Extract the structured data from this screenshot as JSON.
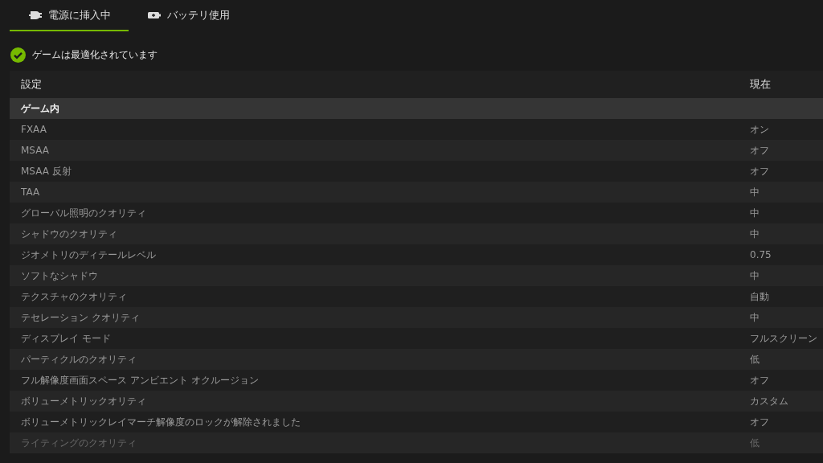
{
  "tabs": [
    {
      "label": "電源に挿入中",
      "selected": true
    },
    {
      "label": "バッテリ使用",
      "selected": false
    }
  ],
  "status": {
    "optimized": true,
    "text": "ゲームは最適化されています"
  },
  "table": {
    "columns": [
      "設定",
      "現在"
    ],
    "rows": [
      {
        "kind": "section",
        "setting": "ゲーム内"
      },
      {
        "kind": "setting",
        "setting": "FXAA",
        "value": "オン"
      },
      {
        "kind": "setting",
        "setting": "MSAA",
        "value": "オフ"
      },
      {
        "kind": "setting",
        "setting": "MSAA 反射",
        "value": "オフ"
      },
      {
        "kind": "setting",
        "setting": "TAA",
        "value": "中"
      },
      {
        "kind": "setting",
        "setting": "グローバル照明のクオリティ",
        "value": "中"
      },
      {
        "kind": "setting",
        "setting": "シャドウのクオリティ",
        "value": "中"
      },
      {
        "kind": "setting",
        "setting": "ジオメトリのディテールレベル",
        "value": "0.75"
      },
      {
        "kind": "setting",
        "setting": "ソフトなシャドウ",
        "value": "中"
      },
      {
        "kind": "setting",
        "setting": "テクスチャのクオリティ",
        "value": "自動"
      },
      {
        "kind": "setting",
        "setting": "テセレーション クオリティ",
        "value": "中"
      },
      {
        "kind": "setting",
        "setting": "ディスプレイ モード",
        "value": "フルスクリーン"
      },
      {
        "kind": "setting",
        "setting": "パーティクルのクオリティ",
        "value": "低"
      },
      {
        "kind": "setting",
        "setting": "フル解像度画面スペース アンビエント オクルージョン",
        "value": "オフ"
      },
      {
        "kind": "setting",
        "setting": "ボリューメトリックオリティ",
        "value": "カスタム"
      },
      {
        "kind": "setting",
        "setting": "ボリューメトリックレイマーチ解像度のロックが解除されました",
        "value": "オフ"
      },
      {
        "kind": "setting",
        "setting": "ライティングのクオリティ",
        "value": "低"
      }
    ]
  }
}
